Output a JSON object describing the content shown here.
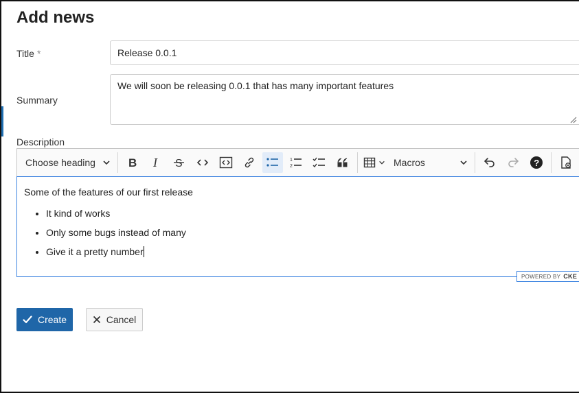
{
  "page": {
    "title": "Add news"
  },
  "form": {
    "title_label": "Title",
    "required_marker": "*",
    "title_value": "Release 0.0.1",
    "summary_label": "Summary",
    "summary_value": "We will soon be releasing 0.0.1 that has many important features",
    "description_label": "Description"
  },
  "toolbar": {
    "heading_dropdown": "Choose heading",
    "macros_dropdown": "Macros",
    "buttons": [
      "bold-icon",
      "italic-icon",
      "strikethrough-icon",
      "code-icon",
      "code-block-icon",
      "link-icon",
      "bulleted-list-icon",
      "numbered-list-icon",
      "todo-list-icon",
      "blockquote-icon",
      "table-icon",
      "undo-icon",
      "redo-icon",
      "help-icon",
      "preview-icon"
    ],
    "active_button": "bulleted-list-icon"
  },
  "editor": {
    "paragraph": "Some of the features of our first release",
    "list_items": [
      "It kind of works",
      "Only some bugs instead of many",
      "Give it a pretty number"
    ],
    "powered_by": "POWERED BY",
    "brand": "CKE"
  },
  "actions": {
    "create_label": "Create",
    "cancel_label": "Cancel"
  },
  "colors": {
    "primary": "#1f66a8",
    "focus_border": "#3b82e0",
    "active_tool_bg": "#e2ecf9"
  }
}
